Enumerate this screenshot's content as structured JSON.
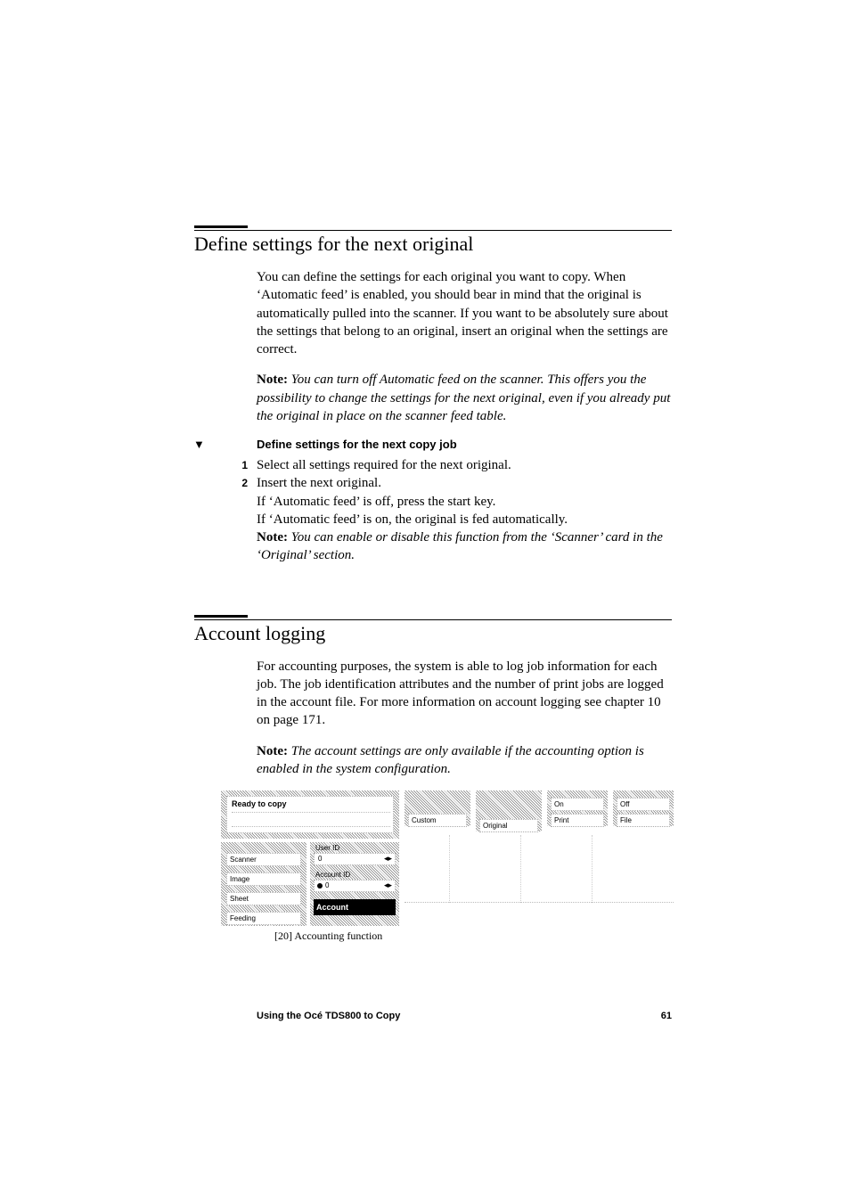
{
  "section1": {
    "title": "Define settings for the next original",
    "para1": "You can define the settings for each original you want to copy. When ‘Automatic feed’ is enabled, you should bear in mind that the original is automatically pulled into the scanner. If you want to be absolutely sure about the settings that belong to an original, insert an original when the settings are correct.",
    "note_label": "Note:",
    "note_text": "You can turn off Automatic feed on the scanner. This offers you the possibility to change the settings for the next original, even if you already put the original in place on the scanner feed table.",
    "procedure": {
      "marker": "▼",
      "heading": "Define settings for the next copy job",
      "steps": [
        {
          "num": "1",
          "text": "Select all settings required for the next original."
        },
        {
          "num": "2",
          "text": "Insert the next original."
        }
      ],
      "after1": "If ‘Automatic feed’ is off, press the start key.",
      "after2": "If ‘Automatic feed’ is on, the original is fed automatically.",
      "inline_note_label": "Note:",
      "inline_note_text": "You can enable or disable this function from the ‘Scanner’ card in the ‘Original’ section."
    }
  },
  "section2": {
    "title": "Account logging",
    "para1": "For accounting purposes, the system is able to log job information for each job. The job identification attributes and the number of print jobs are logged in the account file. For more information on account logging see chapter 10 on page 171.",
    "note_label": "Note:",
    "note_text": "The account settings are only available if the accounting option is enabled in the system configuration."
  },
  "figure": {
    "caption": "[20] Accounting function",
    "status": "Ready to copy",
    "left_tabs": [
      "Scanner",
      "Image",
      "Sheet",
      "Feeding"
    ],
    "center_labels": {
      "user": "User ID",
      "user_val": "0",
      "account": "Account ID",
      "account_val": "0",
      "active_tab": "Account"
    },
    "top_tabs": {
      "custom": "Custom",
      "original": "Original",
      "on": "On",
      "print": "Print",
      "off": "Off",
      "file": "File"
    }
  },
  "footer": {
    "left": "Using the Océ TDS800 to Copy",
    "right": "61"
  }
}
